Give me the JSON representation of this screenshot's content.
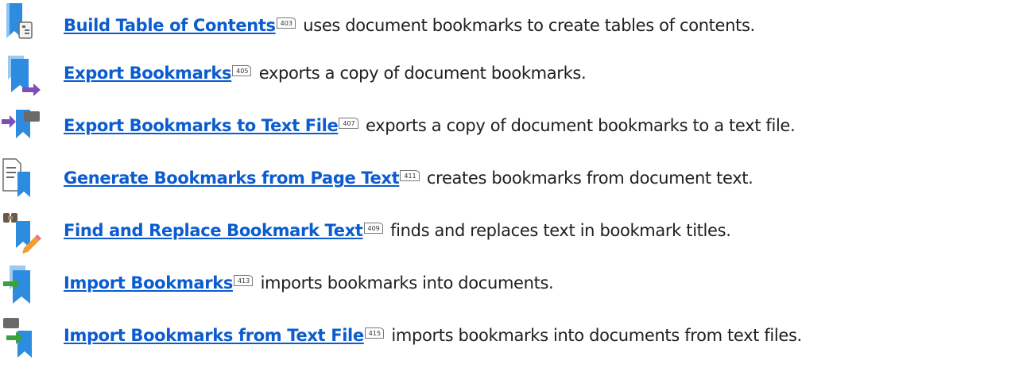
{
  "items": [
    {
      "icon": "toc-bookmark-icon",
      "link": "Build Table of Contents",
      "page": "403",
      "text": "uses document bookmarks to create tables of contents."
    },
    {
      "icon": "export-bookmark-icon",
      "link": "Export Bookmarks",
      "page": "405",
      "text": "exports a copy of document bookmarks."
    },
    {
      "icon": "export-txt-icon",
      "link": "Export Bookmarks to Text File",
      "page": "407",
      "text": "exports a copy of document bookmarks to a text file."
    },
    {
      "icon": "generate-bookmark-icon",
      "link": "Generate Bookmarks from Page Text",
      "page": "411",
      "text": "creates bookmarks from document text."
    },
    {
      "icon": "find-replace-icon",
      "link": "Find and Replace Bookmark Text",
      "page": "409",
      "text": "finds and replaces text in bookmark titles."
    },
    {
      "icon": "import-bookmark-icon",
      "link": "Import Bookmarks",
      "page": "413",
      "text": "imports bookmarks into documents."
    },
    {
      "icon": "import-txt-icon",
      "link": "Import Bookmarks from Text File",
      "page": "415",
      "text": "imports bookmarks into documents from text files."
    }
  ],
  "colors": {
    "link": "#0b5ccf",
    "bookmark_blue": "#2d8be0",
    "arrow": "#7b4fb8",
    "arrow_green": "#3aa040"
  }
}
